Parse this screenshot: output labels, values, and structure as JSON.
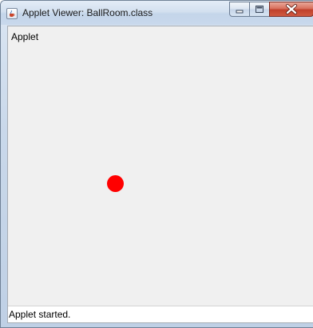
{
  "window": {
    "title": "Applet Viewer: BallRoom.class",
    "app_icon": "java-cup-icon",
    "controls": {
      "minimize_icon": "minimize-icon",
      "maximize_icon": "maximize-icon",
      "close_icon": "close-icon"
    }
  },
  "applet": {
    "menu_label": "Applet",
    "ball_color": "#ff0000"
  },
  "status": {
    "text": "Applet started."
  },
  "colors": {
    "close_button": "#c0402b",
    "titlebar": "#c9d8ea"
  }
}
